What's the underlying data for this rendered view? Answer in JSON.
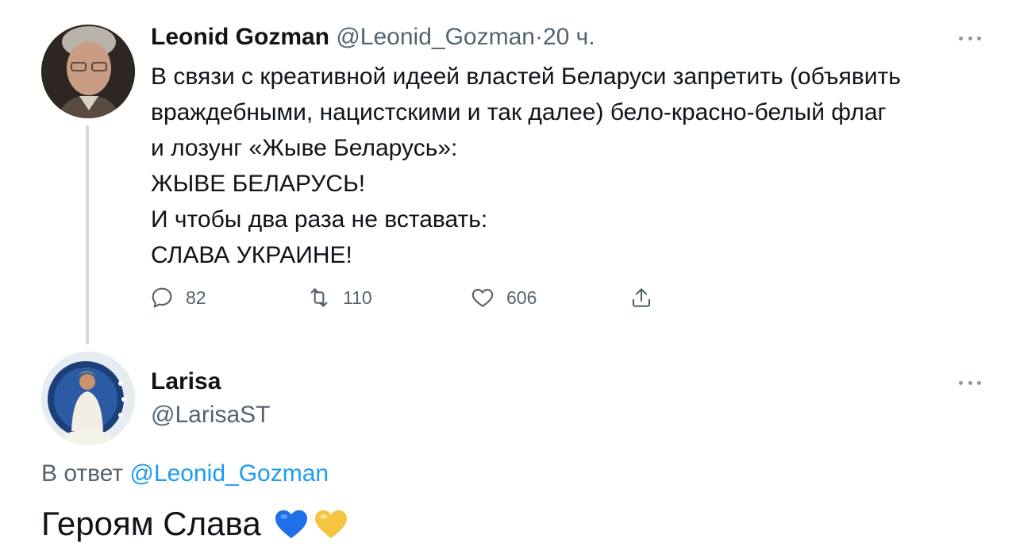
{
  "tweet": {
    "author_name": "Leonid Gozman",
    "author_handle": "@Leonid_Gozman",
    "separator": "·",
    "time": "20 ч.",
    "lines": [
      "В связи с креативной идеей властей Беларуси запретить (объявить",
      "враждебными, нацистскими и так далее) бело-красно-белый флаг",
      "и лозунг «Жыве Беларусь»:",
      "ЖЫВЕ БЕЛАРУСЬ!",
      "И чтобы два раза не вставать:",
      "СЛАВА УКРАИНЕ!"
    ],
    "replies": "82",
    "retweets": "110",
    "likes": "606"
  },
  "reply": {
    "author_name": "Larisa",
    "author_handle": "@LarisaST",
    "reply_prefix": "В ответ",
    "reply_target": "@Leonid_Gozman",
    "text": "Героям Слава"
  },
  "icons": {
    "reply": "comment-icon",
    "retweet": "retweet-icon",
    "like": "heart-icon",
    "share": "share-icon",
    "more": "more-icon"
  },
  "colors": {
    "text": "#0f1419",
    "muted": "#536471",
    "link": "#1d9bf0",
    "heart_blue": "#1f6fe8",
    "heart_yellow": "#f5c542"
  }
}
